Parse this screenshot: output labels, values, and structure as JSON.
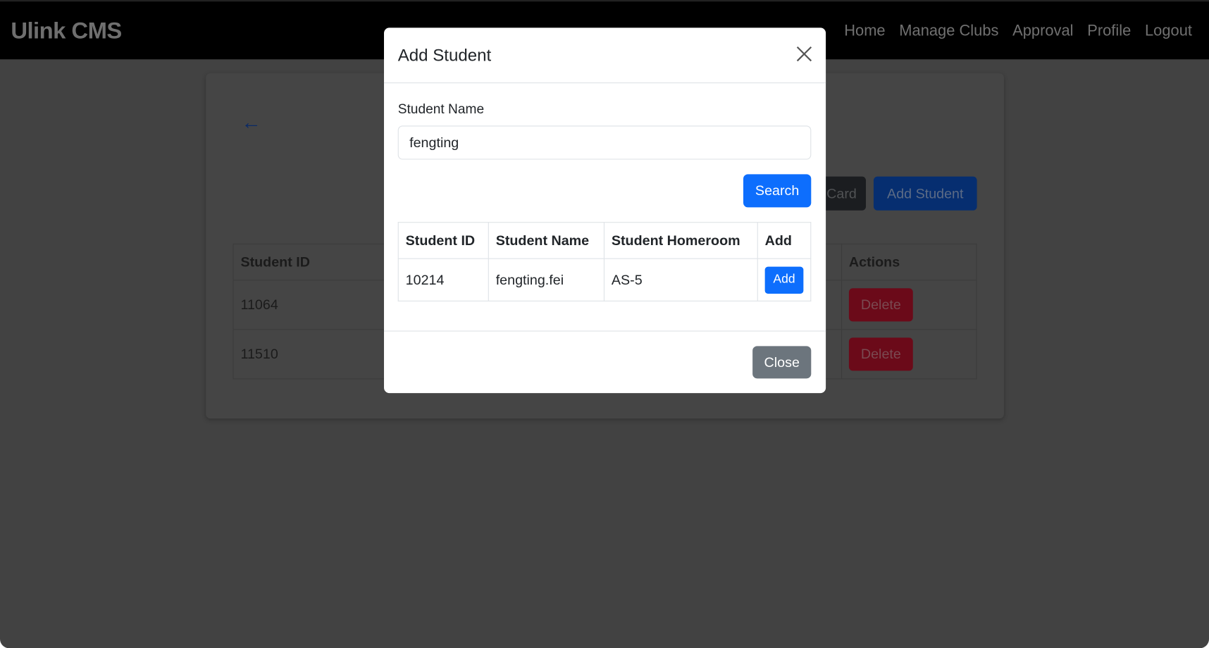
{
  "navbar": {
    "brand": "Ulink CMS",
    "items": [
      "Home",
      "Manage Clubs",
      "Approval",
      "Profile",
      "Logout"
    ]
  },
  "page": {
    "back_icon": "arrow-left-icon",
    "buttons": {
      "card": "Card",
      "add_student": "Add Student"
    },
    "table": {
      "headers": {
        "id": "Student ID",
        "actions": "Actions"
      },
      "rows": [
        {
          "id": "11064",
          "action": "Delete"
        },
        {
          "id": "11510",
          "action": "Delete"
        }
      ]
    }
  },
  "modal": {
    "title": "Add Student",
    "field_label": "Student Name",
    "field_value": "fengting",
    "search_label": "Search",
    "table": {
      "headers": [
        "Student ID",
        "Student Name",
        "Student Homeroom",
        "Add"
      ],
      "rows": [
        {
          "id": "10214",
          "name": "fengting.fei",
          "homeroom": "AS-5",
          "add": "Add"
        }
      ]
    },
    "close_label": "Close"
  },
  "colors": {
    "primary": "#0d6efd",
    "secondary": "#6c757d",
    "danger": "#dc3545"
  }
}
